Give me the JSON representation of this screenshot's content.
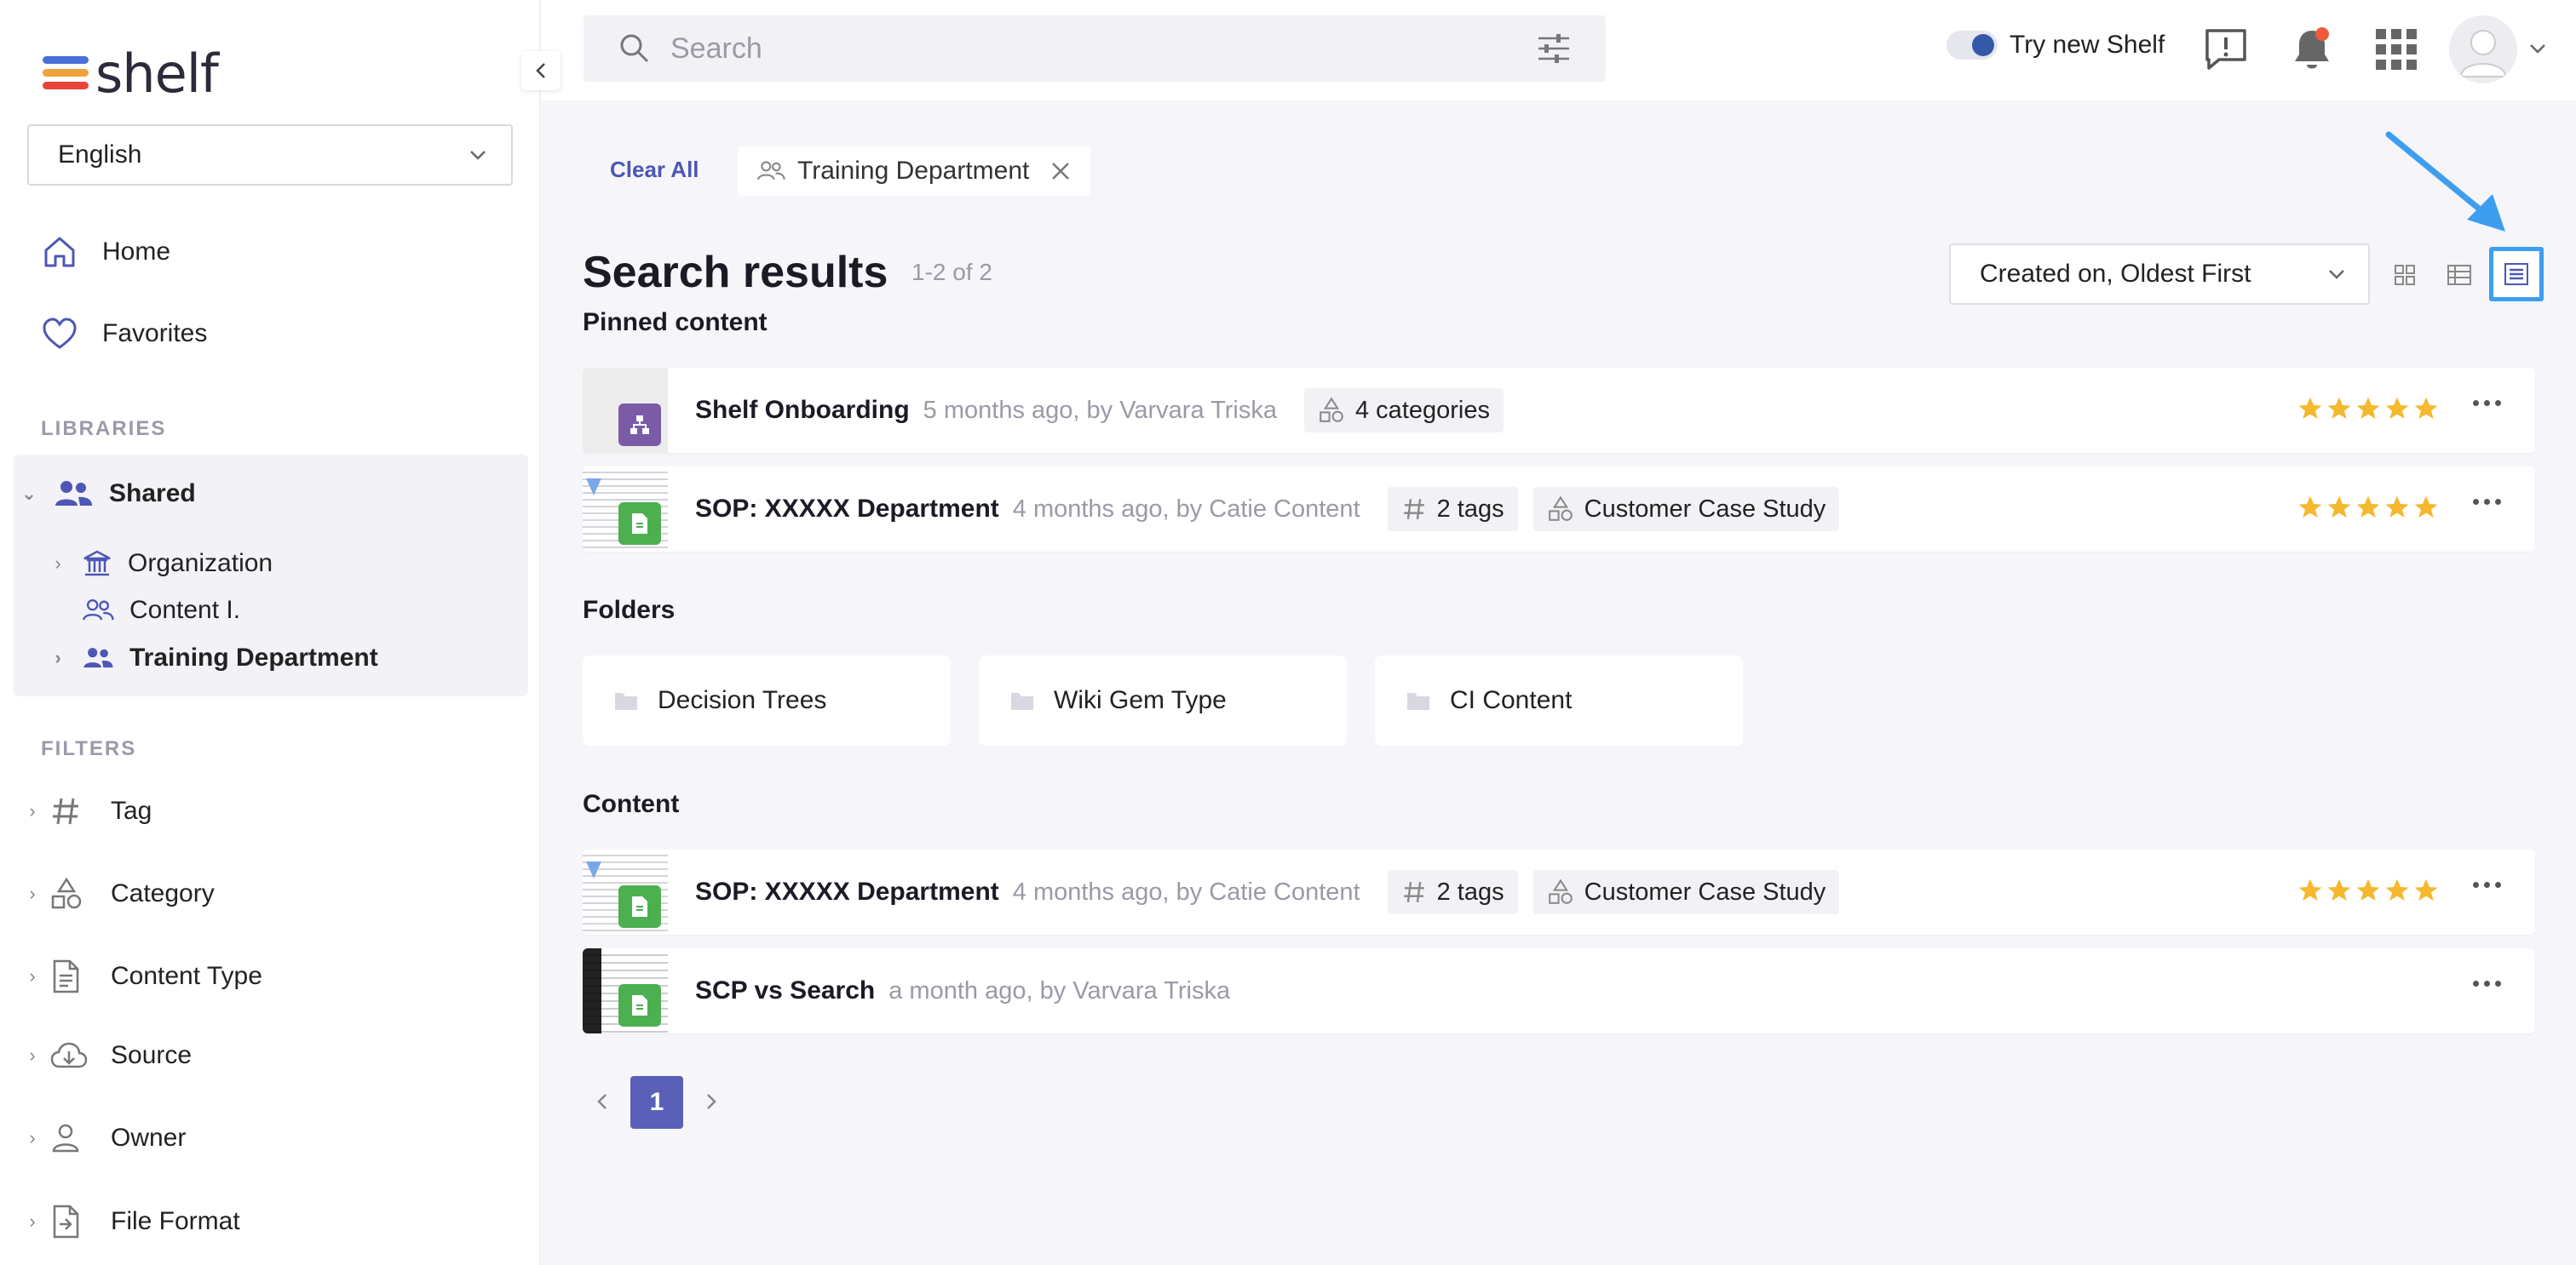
{
  "sidebar": {
    "logo_text": "shelf",
    "language": "English",
    "nav": [
      {
        "label": "Home",
        "icon": "home-icon"
      },
      {
        "label": "Favorites",
        "icon": "heart-icon"
      }
    ],
    "libraries_label": "LIBRARIES",
    "shared_label": "Shared",
    "tree": [
      {
        "label": "Organization",
        "icon": "institution-icon"
      },
      {
        "label": "Content I.",
        "icon": "group-icon"
      },
      {
        "label": "Training Department",
        "icon": "group-icon"
      }
    ],
    "filters_label": "FILTERS",
    "filters": [
      {
        "label": "Tag",
        "icon": "hash-icon"
      },
      {
        "label": "Category",
        "icon": "category-icon"
      },
      {
        "label": "Content Type",
        "icon": "document-icon"
      },
      {
        "label": "Source",
        "icon": "cloud-download-icon"
      },
      {
        "label": "Owner",
        "icon": "person-icon"
      },
      {
        "label": "File Format",
        "icon": "file-format-icon"
      }
    ]
  },
  "topbar": {
    "search_placeholder": "Search",
    "try_new": "Try new Shelf"
  },
  "filters_bar": {
    "clear_all": "Clear All",
    "active_filter": "Training Department"
  },
  "results": {
    "title": "Search results",
    "count": "1-2 of 2",
    "sort": "Created on, Oldest First",
    "pinned_label": "Pinned content",
    "folders_label": "Folders",
    "content_label": "Content"
  },
  "pinned": [
    {
      "title": "Shelf Onboarding",
      "meta": "5 months ago, by Varvara Triska",
      "chips": [
        {
          "label": "4 categories",
          "icon": "category-icon"
        }
      ],
      "rating": 5,
      "type_color": "#7b5aa6"
    },
    {
      "title": "SOP: XXXXX Department",
      "meta": "4 months ago, by Catie Content",
      "chips": [
        {
          "label": "2 tags",
          "icon": "hash-icon"
        },
        {
          "label": "Customer Case Study",
          "icon": "category-icon"
        }
      ],
      "rating": 5,
      "type_color": "#4caf50"
    }
  ],
  "folders": [
    {
      "label": "Decision Trees"
    },
    {
      "label": "Wiki Gem Type"
    },
    {
      "label": "CI Content"
    }
  ],
  "content": [
    {
      "title": "SOP: XXXXX Department",
      "meta": "4 months ago, by Catie Content",
      "chips": [
        {
          "label": "2 tags",
          "icon": "hash-icon"
        },
        {
          "label": "Customer Case Study",
          "icon": "category-icon"
        }
      ],
      "rating": 5,
      "type_color": "#4caf50"
    },
    {
      "title": "SCP vs Search",
      "meta": "a month ago, by Varvara Triska",
      "chips": [],
      "rating": 0,
      "type_color": "#4caf50"
    }
  ],
  "pagination": {
    "current": "1"
  },
  "colors": {
    "accent": "#4d57b5",
    "star": "#f5b82e",
    "annotation_arrow": "#3d9ef0"
  }
}
